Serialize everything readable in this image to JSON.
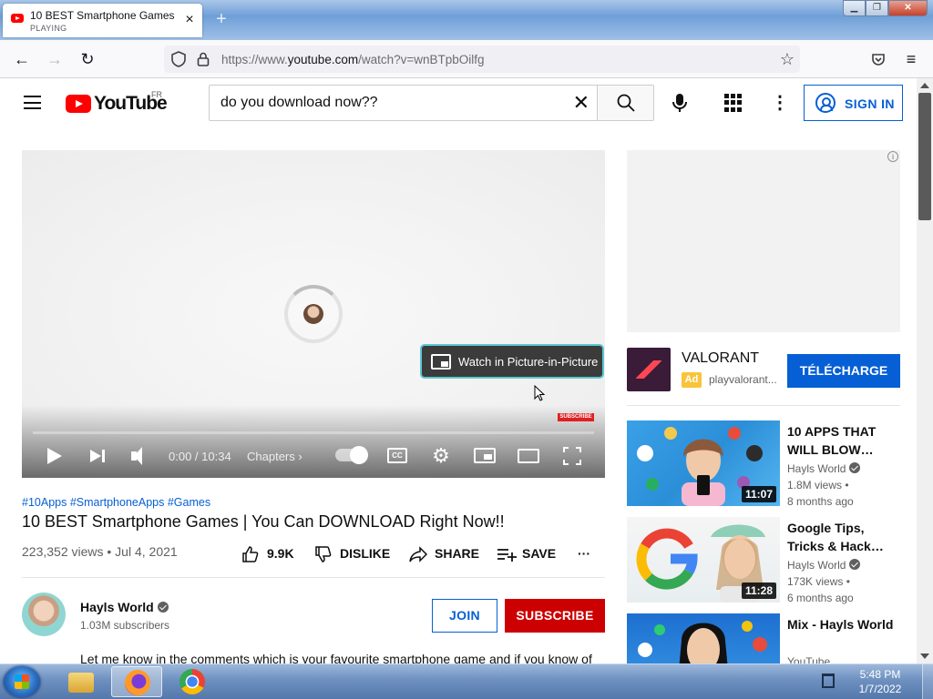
{
  "browser": {
    "tab_title": "10 BEST Smartphone Games | You Can DOWNLOAD Right Now!!",
    "tab_status": "PLAYING",
    "url_prefix": "https://www.",
    "url_domain": "youtube.com",
    "url_path": "/watch?v=wnBTpbOilfg"
  },
  "header": {
    "logo_text": "YouTube",
    "country_code": "FR",
    "search_value": "do you download now??",
    "sign_in_label": "SIGN IN"
  },
  "player": {
    "pip_label": "Watch in Picture-in-Picture",
    "subscribe_badge": "SUBSCRIBE",
    "time": "0:00 / 10:34",
    "chapters_label": "Chapters ›",
    "cc_label": "CC",
    "progress": 0
  },
  "video": {
    "hashtags": "#10Apps #SmartphoneApps #Games",
    "title": "10 BEST Smartphone Games | You Can DOWNLOAD Right Now!!",
    "views_date": "223,352 views • Jul 4, 2021",
    "likes": "9.9K",
    "dislike_label": "DISLIKE",
    "share_label": "SHARE",
    "save_label": "SAVE",
    "more_label": "···"
  },
  "channel": {
    "name": "Hayls World",
    "subscribers": "1.03M subscribers",
    "join_label": "JOIN",
    "subscribe_label": "SUBSCRIBE",
    "description": "Let me know in the comments which is your favourite smartphone game and if you know of"
  },
  "ad": {
    "info": "i",
    "name": "VALORANT",
    "tag": "Ad",
    "domain": "playvalorant...",
    "cta_label": "TÉLÉCHARGE"
  },
  "recommendations": [
    {
      "title": "10 APPS THAT WILL BLOW…",
      "channel": "Hayls World",
      "views": "1.8M views •",
      "date": "8 months ago",
      "duration": "11:07"
    },
    {
      "title": "Google Tips, Tricks & Hack…",
      "channel": "Hayls World",
      "views": "173K views •",
      "date": "6 months ago",
      "duration": "11:28"
    },
    {
      "title": "Mix - Hayls World",
      "channel": "YouTube",
      "views": "",
      "date": "",
      "duration": ""
    }
  ],
  "taskbar": {
    "time": "5:48 PM",
    "date": "1/7/2022"
  },
  "colors": {
    "youtube_red": "#ff0000",
    "subscribe_red": "#cc0000",
    "link_blue": "#065fd4",
    "ad_yellow": "#f9c43a"
  }
}
